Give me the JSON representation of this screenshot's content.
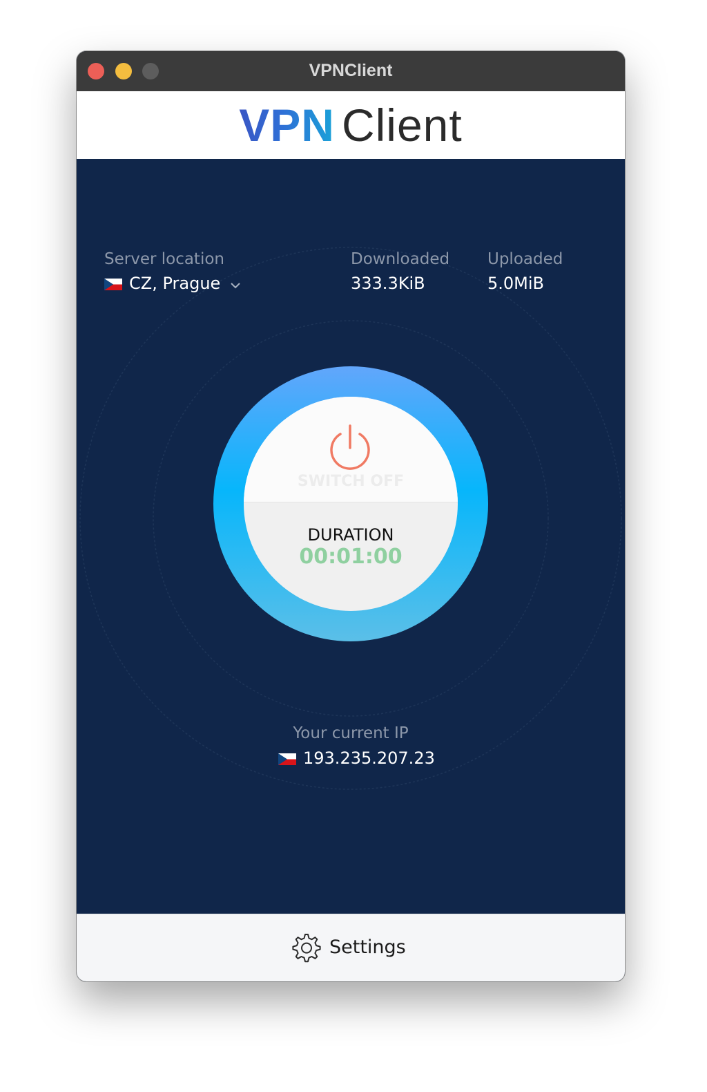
{
  "window": {
    "title": "VPNClient"
  },
  "logo": {
    "part1": "VPN",
    "part2": "Client"
  },
  "server": {
    "label": "Server location",
    "value": "CZ, Prague",
    "flag_icon": "czech-flag-icon"
  },
  "stats": {
    "downloaded_label": "Downloaded",
    "downloaded_value": "333.3KiB",
    "uploaded_label": "Uploaded",
    "uploaded_value": "5.0MiB"
  },
  "power": {
    "switch_label": "SWITCH OFF",
    "duration_label": "DURATION",
    "duration_value": "00:01:00",
    "icon": "power-icon"
  },
  "ip": {
    "label": "Your current IP",
    "value": "193.235.207.23",
    "flag_icon": "czech-flag-icon"
  },
  "footer": {
    "settings_label": "Settings",
    "icon": "gear-icon"
  },
  "colors": {
    "main_bg": "#10264a",
    "dial_top": "#62a6fb",
    "dial_mid": "#07b6fb",
    "power_icon": "#f07a63",
    "duration_value": "#8fd0a0"
  }
}
